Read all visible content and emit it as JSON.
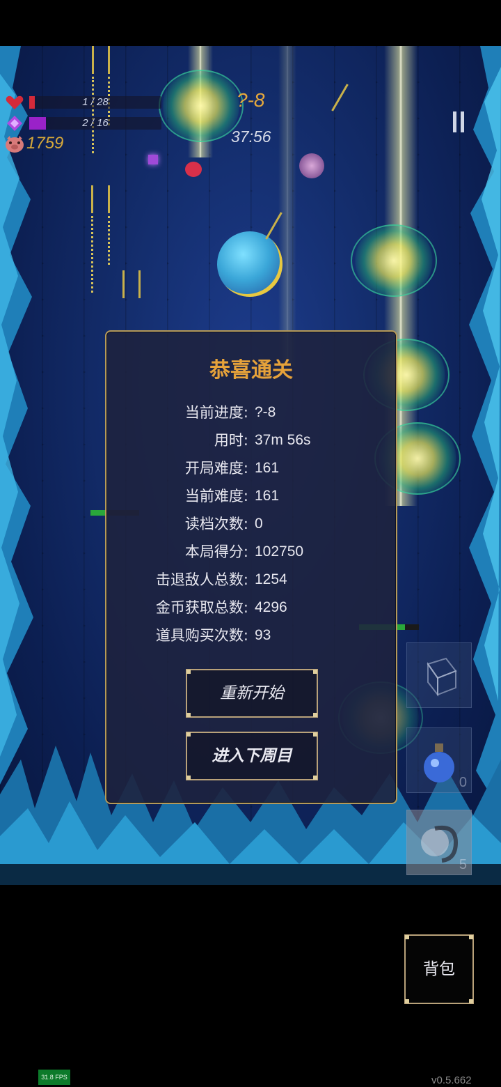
{
  "hud": {
    "health_text": "1 / 28",
    "health_fraction": 0.036,
    "mana_text": "2 / 16",
    "mana_fraction": 0.125,
    "gold": "1759",
    "stage": "?-8",
    "timer": "37:56"
  },
  "dialog": {
    "title": "恭喜通关",
    "stats": [
      {
        "label": "当前进度:",
        "value": "?-8"
      },
      {
        "label": "用时:",
        "value": "37m 56s"
      },
      {
        "label": "开局难度:",
        "value": "161"
      },
      {
        "label": "当前难度:",
        "value": "161"
      },
      {
        "label": "读档次数:",
        "value": "0"
      },
      {
        "label": "本局得分:",
        "value": "102750"
      },
      {
        "label": "击退敌人总数:",
        "value": "1254"
      },
      {
        "label": "金币获取总数:",
        "value": "4296"
      },
      {
        "label": "道具购买次数:",
        "value": "93"
      }
    ],
    "restart_label": "重新开始",
    "next_cycle_label": "进入下周目"
  },
  "items": {
    "slot2_count": "0",
    "slot3_count": "5"
  },
  "bag_label": "背包",
  "fps": "31.8 FPS",
  "version": "v0.5.662",
  "colors": {
    "health": "#d42a3a",
    "mana": "#9a22c8",
    "gold_text": "#d6a83a",
    "accent_title": "#e6a23a",
    "frame_gold": "#b59a5a"
  }
}
